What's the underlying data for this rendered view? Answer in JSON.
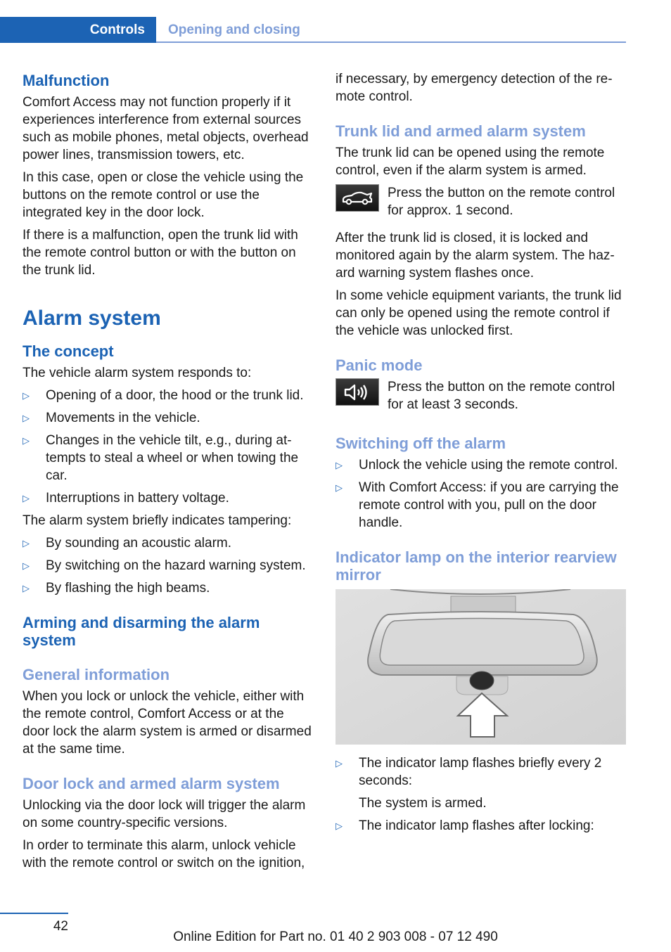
{
  "header": {
    "chapter": "Controls",
    "section": "Opening and closing"
  },
  "left": {
    "malfunction": {
      "title": "Malfunction",
      "paragraphs": [
        "Comfort Access may not function properly if it experiences interference from external sources such as mobile phones, metal objects, overhead power lines, transmission towers, etc.",
        "In this case, open or close the vehicle using the buttons on the remote control or use the integrated key in the door lock.",
        "If there is a malfunction, open the trunk lid with the remote control button or with the button on the trunk lid."
      ]
    },
    "alarm_title": "Alarm system",
    "concept": {
      "title": "The concept",
      "intro": "The vehicle alarm system responds to:",
      "items": [
        "Opening of a door, the hood or the trunk lid.",
        "Movements in the vehicle.",
        "Changes in the vehicle tilt, e.g., during at-tempts to steal a wheel or when towing the car.",
        "Interruptions in battery voltage."
      ],
      "intro2": "The alarm system briefly indicates tampering:",
      "items2": [
        "By sounding an acoustic alarm.",
        "By switching on the hazard warning system.",
        "By flashing the high beams."
      ]
    },
    "arming": {
      "title": "Arming and disarming the alarm system",
      "general_title": "General information",
      "general_text": "When you lock or unlock the vehicle, either with the remote control, Comfort Access or at the door lock the alarm system is armed or disarmed at the same time.",
      "door_title": "Door lock and armed alarm system",
      "door_p1": "Unlocking via the door lock will trigger the alarm on some country-specific versions.",
      "door_p2": "In order to terminate this alarm, unlock vehicle with the remote control or switch on the ignition,"
    }
  },
  "right": {
    "continued": "if necessary, by emergency detection of the re-mote control.",
    "trunk": {
      "title": "Trunk lid and armed alarm system",
      "text": "The trunk lid can be opened using the remote control, even if the alarm system is armed.",
      "icon_text": "Press the button on the remote control for approx. 1 second.",
      "p2": "After the trunk lid is closed, it is locked and monitored again by the alarm system. The haz-ard warning system flashes once.",
      "p3": "In some vehicle equipment variants, the trunk lid can only be opened using the remote control if the vehicle was unlocked first."
    },
    "panic": {
      "title": "Panic mode",
      "icon_text": "Press the button on the remote control for at least 3 seconds."
    },
    "switching": {
      "title": "Switching off the alarm",
      "items": [
        "Unlock the vehicle using the remote control.",
        "With Comfort Access: if you are carrying the remote control with you, pull on the door handle."
      ]
    },
    "indicator": {
      "title": "Indicator lamp on the interior rearview mirror",
      "item1": "The indicator lamp flashes briefly every 2 seconds:",
      "item1_sub": "The system is armed.",
      "item2": "The indicator lamp flashes after locking:"
    }
  },
  "footer": {
    "page": "42",
    "edition": "Online Edition for Part no. 01 40 2 903 008 - 07 12 490"
  },
  "colors": {
    "primary_blue": "#1c63b4",
    "light_blue": "#7f9ed8"
  }
}
